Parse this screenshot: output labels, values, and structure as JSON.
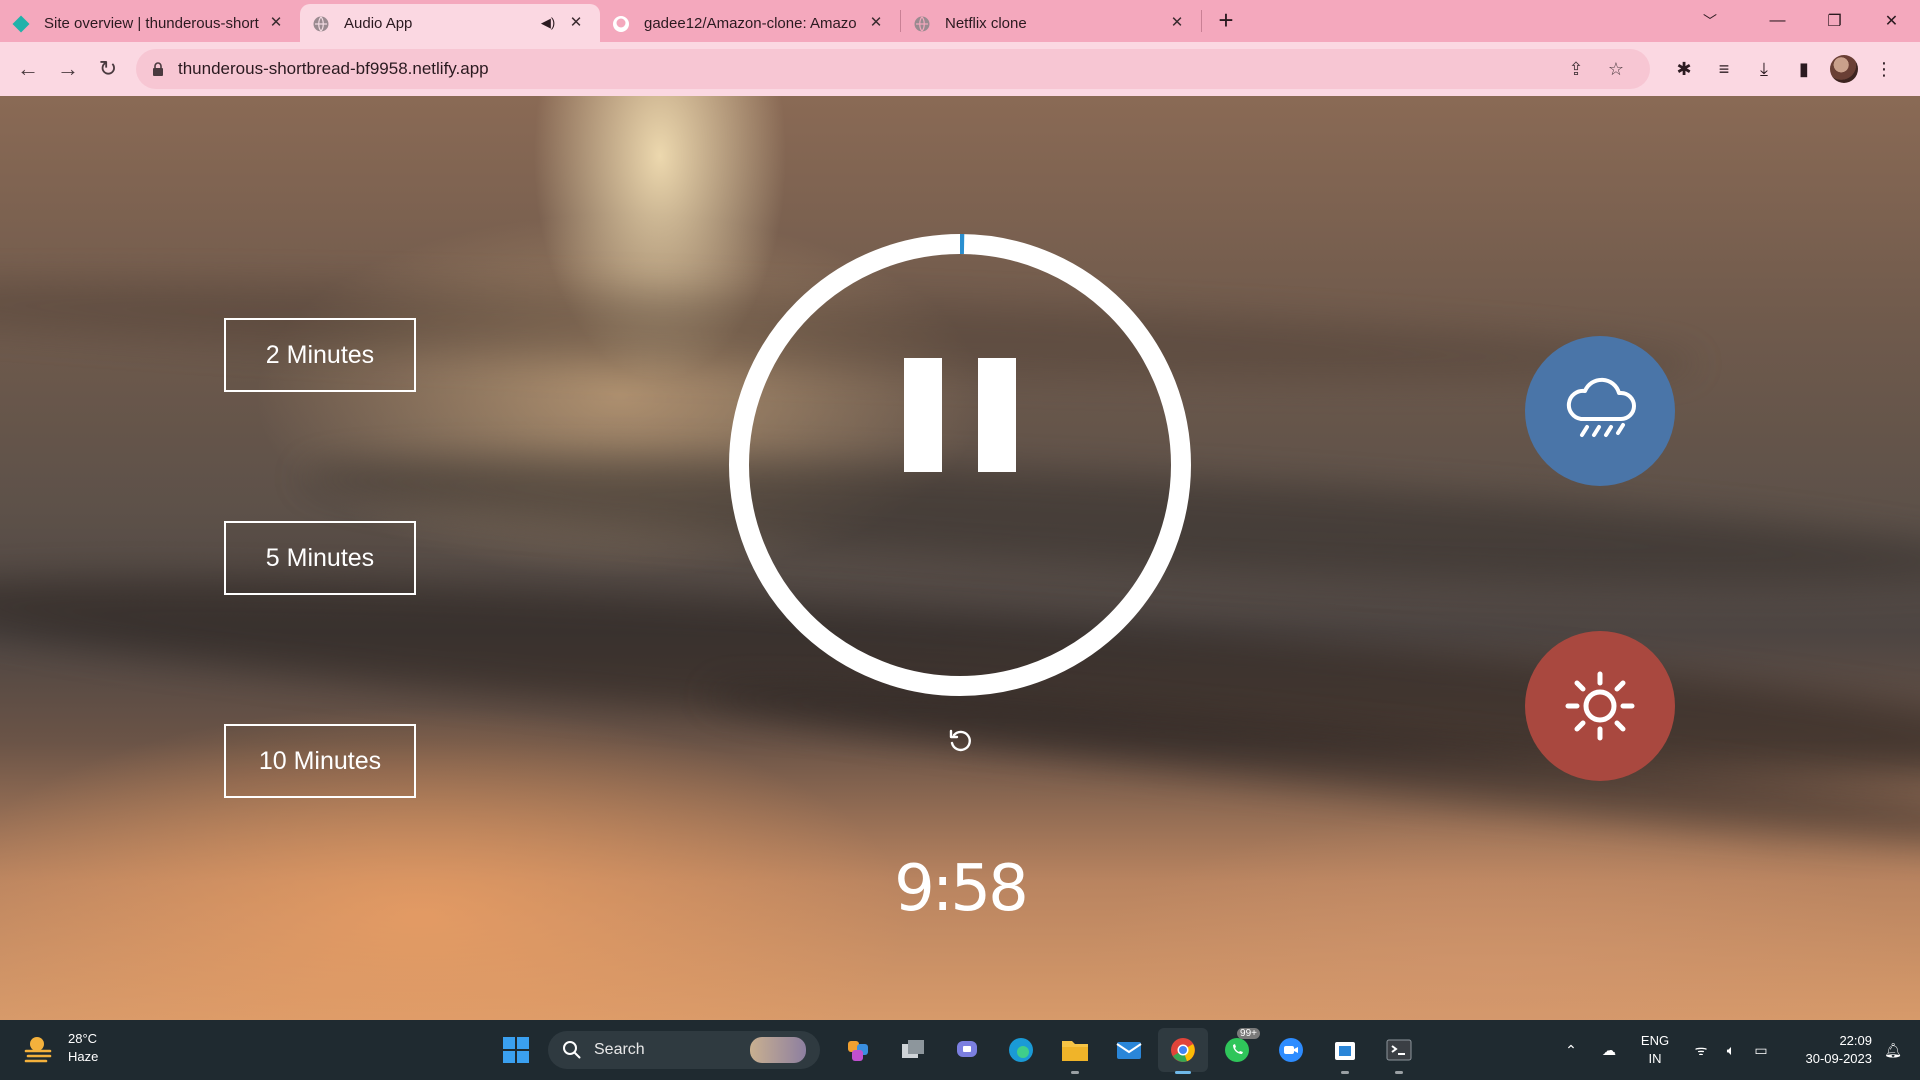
{
  "browser": {
    "tabs": [
      {
        "title": "Site overview | thunderous-short",
        "icon": "netlify-icon",
        "active": false
      },
      {
        "title": "Audio App",
        "icon": "globe-icon",
        "active": true,
        "audio": true
      },
      {
        "title": "gadee12/Amazon-clone: Amazo",
        "icon": "github-icon",
        "active": false
      },
      {
        "title": "Netflix clone",
        "icon": "globe-icon",
        "active": false
      }
    ],
    "new_tab_label": "+",
    "url": "thunderous-shortbread-bf9958.netlify.app"
  },
  "app": {
    "duration_buttons": [
      "2 Minutes",
      "5 Minutes",
      "10 Minutes"
    ],
    "timer": "9:58",
    "progress_fraction": 0.003,
    "player_state": "playing",
    "sounds": [
      {
        "name": "rain",
        "icon": "cloud-rain-icon",
        "color": "#4a75a8"
      },
      {
        "name": "sun",
        "icon": "sun-icon",
        "color": "#a9483f"
      }
    ],
    "ring_color": "#ffffff",
    "progress_color": "#2a8fd0"
  },
  "taskbar": {
    "weather_temp": "28°C",
    "weather_desc": "Haze",
    "search_label": "Search",
    "whatsapp_badge": "99+",
    "lang_line1": "ENG",
    "lang_line2": "IN",
    "time": "22:09",
    "date": "30-09-2023"
  }
}
